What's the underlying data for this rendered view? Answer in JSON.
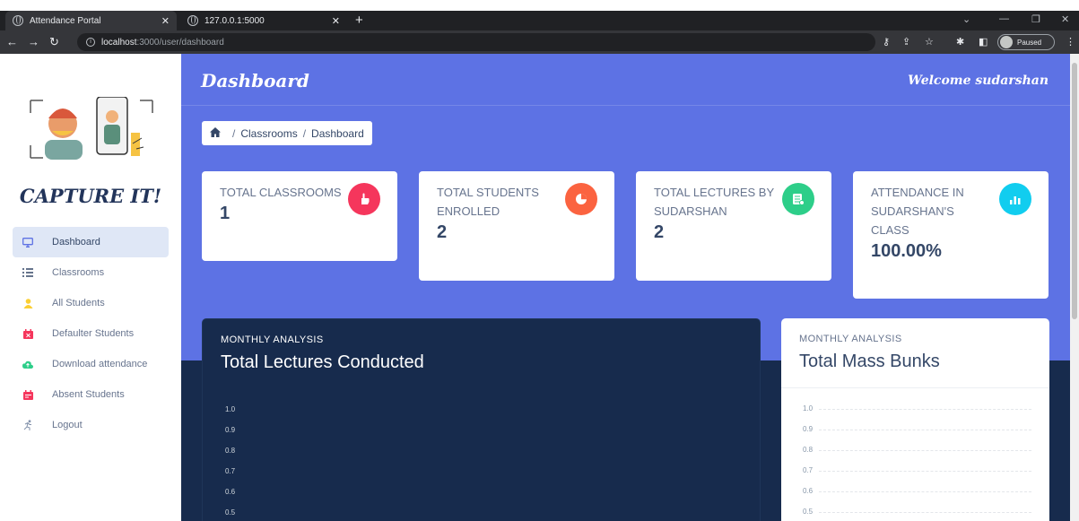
{
  "browser": {
    "tabs": [
      {
        "title": "Attendance Portal"
      },
      {
        "title": "127.0.0.1:5000"
      }
    ],
    "url_host": "localhost",
    "url_path": ":3000/user/dashboard",
    "profile_status": "Paused"
  },
  "sidebar": {
    "brand": "CAPTURE IT!",
    "items": [
      {
        "label": "Dashboard",
        "icon": "monitor-icon",
        "color": "#5e72e4"
      },
      {
        "label": "Classrooms",
        "icon": "list-icon",
        "color": "#344767"
      },
      {
        "label": "All Students",
        "icon": "user-icon",
        "color": "#fbcf33"
      },
      {
        "label": "Defaulter Students",
        "icon": "calendar-x-icon",
        "color": "#f5365c"
      },
      {
        "label": "Download attendance",
        "icon": "cloud-upload-icon",
        "color": "#2dce89"
      },
      {
        "label": "Absent Students",
        "icon": "calendar-icon",
        "color": "#f5365c"
      },
      {
        "label": "Logout",
        "icon": "running-person-icon",
        "color": "#8392ab"
      }
    ]
  },
  "header": {
    "title": "Dashboard",
    "welcome_prefix": "Welcome",
    "username": "sudarshan"
  },
  "breadcrumb": [
    "Classrooms",
    "Dashboard"
  ],
  "stats": [
    {
      "label": "TOTAL CLASSROOMS",
      "value": "1",
      "icon": "hand-pointer-icon",
      "color": "#f5365c"
    },
    {
      "label": "TOTAL STUDENTS ENROLLED",
      "value": "2",
      "icon": "pie-chart-icon",
      "color": "#fb6340"
    },
    {
      "label": "TOTAL LECTURES BY SUDARSHAN",
      "value": "2",
      "icon": "database-icon",
      "color": "#2dce89"
    },
    {
      "label": "ATTENDANCE IN SUDARSHAN'S CLASS",
      "value": "100.00%",
      "icon": "bar-chart-icon",
      "color": "#11cdef"
    }
  ],
  "chart_data": [
    {
      "type": "line",
      "subtitle": "MONTHLY ANALYSIS",
      "title": "Total Lectures Conducted",
      "y_ticks": [
        "1.0",
        "0.9",
        "0.8",
        "0.7",
        "0.6",
        "0.5"
      ],
      "grid": false
    },
    {
      "type": "line",
      "subtitle": "MONTHLY ANALYSIS",
      "title": "Total Mass Bunks",
      "y_ticks": [
        "1.0",
        "0.9",
        "0.8",
        "0.7",
        "0.6",
        "0.5"
      ],
      "grid": true
    }
  ]
}
